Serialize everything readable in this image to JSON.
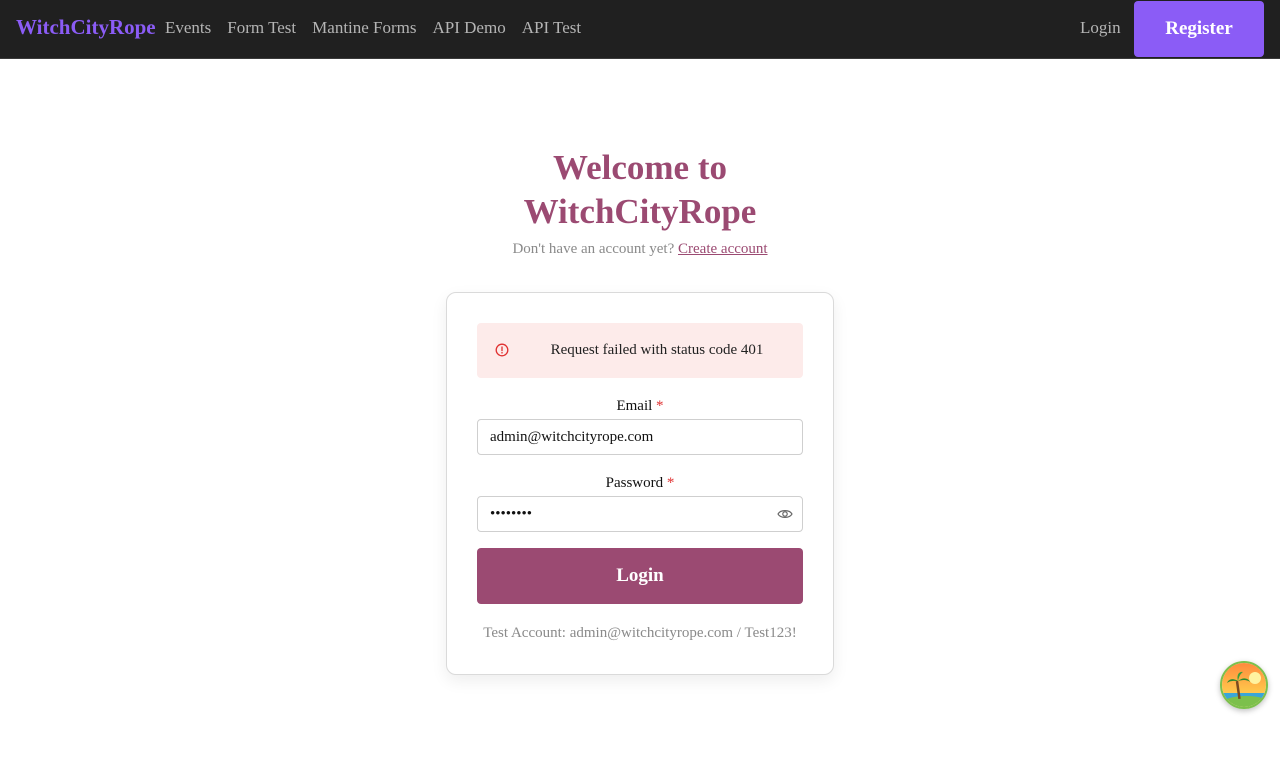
{
  "header": {
    "brand": "WitchCityRope",
    "nav": [
      {
        "label": "Events"
      },
      {
        "label": "Form Test"
      },
      {
        "label": "Mantine Forms"
      },
      {
        "label": "API Demo"
      },
      {
        "label": "API Test"
      }
    ],
    "login_label": "Login",
    "register_label": "Register"
  },
  "page": {
    "title": "Welcome to WitchCityRope",
    "subtitle_prefix": "Don't have an account yet?",
    "subtitle_link": "Create account"
  },
  "form": {
    "error_message": "Request failed with status code 401",
    "email": {
      "label": "Email",
      "required_mark": "*",
      "value": "admin@witchcityrope.com"
    },
    "password": {
      "label": "Password",
      "required_mark": "*",
      "value": "Test123!"
    },
    "submit_label": "Login",
    "test_account": "Test Account: admin@witchcityrope.com / Test123!"
  },
  "icons": {
    "alert": "alert-circle-icon",
    "password_toggle": "eye-icon",
    "avatar": "beach-avatar"
  },
  "colors": {
    "brand": "#8b5cf6",
    "accent": "#9b4a72",
    "header_bg": "#202020",
    "error_bg": "#fdebea",
    "error_icon": "#e03131"
  }
}
